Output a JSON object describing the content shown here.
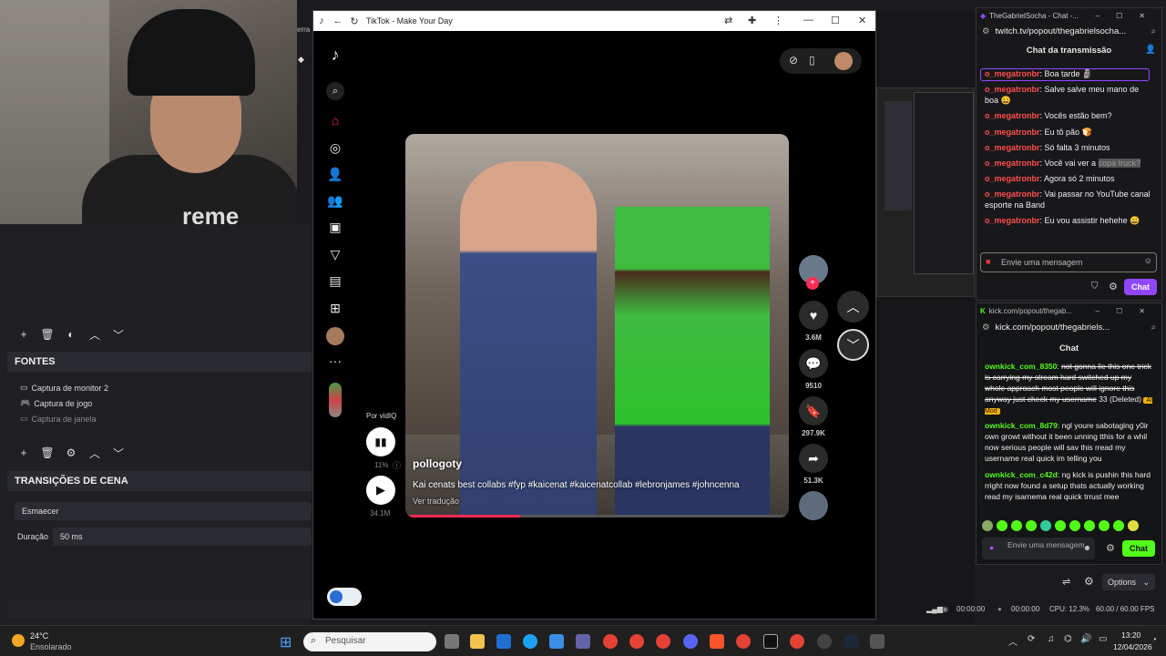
{
  "webcam": {
    "shirt_text": "reme"
  },
  "obs": {
    "sources_header": "FONTES",
    "sources": [
      {
        "label": "Captura de monitor 2",
        "enabled": true
      },
      {
        "label": "Captura de jogo",
        "enabled": true
      },
      {
        "label": "Captura de janela",
        "enabled": false
      }
    ],
    "transitions_header": "TRANSIÇÕES DE CENA",
    "transition_value": "Esmaecer",
    "duration_label": "Duração",
    "duration_value": "50 ms",
    "partial_label": "erra"
  },
  "tiktok_window": {
    "title": "TikTok - Make Your Day",
    "by_label": "Por vidIQ",
    "vidiq_percent": "11%",
    "views": "34.1M",
    "author": "pollogoty",
    "caption": "Kai cenats best collabs #fyp #kaicenat #kaicenatcollab #lebronjames #johncenna",
    "see_translation": "Ver tradução",
    "likes": "3.6M",
    "comments": "9510",
    "saves": "297.9K",
    "shares": "51.3K"
  },
  "twitch": {
    "window_title": "TheGabrielSocha - Chat -...",
    "url": "twitch.tv/popout/thegabrielsocha...",
    "header": "Chat da transmissão",
    "messages": [
      {
        "user": "o_megatronbr",
        "text": ": Boa tarde 🗿"
      },
      {
        "user": "o_megatronbr",
        "text": ": Salve salve meu mano de boa 😄"
      },
      {
        "user": "o_megatronbr",
        "text": ": Vocês estão bem?"
      },
      {
        "user": "o_megatronbr",
        "text": ": Eu tô pão 🍞"
      },
      {
        "user": "o_megatronbr",
        "text": ": Só falta 3 minutos"
      },
      {
        "user": "o_megatronbr",
        "text": ": Você vai ver a ",
        "highlight": "copa truck?"
      },
      {
        "user": "o_megatronbr",
        "text": ": Agora só 2 minutos"
      },
      {
        "user": "o_megatronbr",
        "text": ": Vai passar no YouTube canal esporte na Band"
      },
      {
        "user": "o_megatronbr",
        "text": ": Eu vou assistir hehehe 😄"
      }
    ],
    "input_placeholder": "Envie uma mensagem",
    "chat_button": "Chat"
  },
  "kick": {
    "window_title": "kick.com/popout/thegab...",
    "url": "kick.com/popout/thegabriels...",
    "header": "Chat",
    "messages": [
      {
        "user": "ownkick_com_8350",
        "text": "not gonna lie this one trick is carrying my stream hard switched up my whole approach most people will ignore this anyway just check my username",
        "struck": true,
        "suffix": " 33 (Deleted)",
        "badge": "AI Mod"
      },
      {
        "user": "ownkick_com_8d79",
        "text": "ngl youre sabotaging y0ir own growt without it been unning tthis for a whil now serious people will sav this rread my username real quick im telling you",
        "struck": false
      },
      {
        "user": "ownkick_com_c42d",
        "text": "ng kick is pushin this hard rright now found a setup thats actually working read my isarnema real quick trrust mee",
        "struck": false
      }
    ],
    "input_placeholder": "Envie uma mensagem",
    "chat_button": "Chat"
  },
  "obs_status": {
    "options_label": "Options",
    "time1": "00:00:00",
    "time2": "00:00:00",
    "cpu": "CPU: 12.3%",
    "fps": "60.00 / 60.00 FPS"
  },
  "taskbar": {
    "weather_temp": "24°C",
    "weather_desc": "Ensolarado",
    "search_placeholder": "Pesquisar",
    "time": "13:20",
    "date": "12/04/2026"
  },
  "colors": {
    "twitch_purple": "#9147ff",
    "kick_green": "#53fc18",
    "tiktok_red": "#fe2c55"
  }
}
